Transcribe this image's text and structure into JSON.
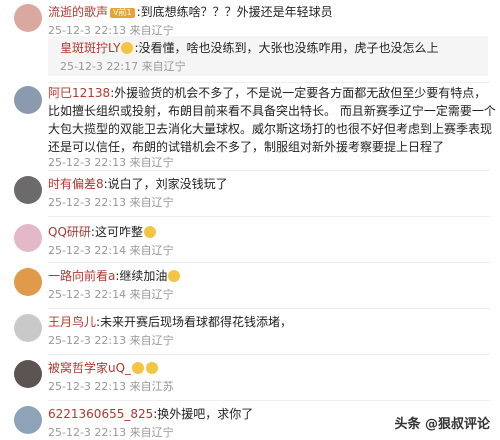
{
  "comments": [
    {
      "name": "流逝的歌声",
      "badge": "V前1",
      "text": ":到底想练啥？？？外援还是年轻球员",
      "date": "25-12-3 22:13",
      "loc": "来自辽宁"
    },
    {
      "name": "皇斑斑拧LY",
      "text": ":没看懂，啥也没练到，大张也没练咋用，虎子也没怎么上",
      "date": "25-12-3 22:17",
      "loc": "来自辽宁"
    },
    {
      "name": "阿巳12138",
      "text": ":外援验货的机会不多了，不是说一定要各方面都无敌但至少要有特点，比如擅长组织或投射，布朗目前来看不具备突出特长。 而且新赛季辽宁一定需要一个大包大揽型的双能卫去消化大量球权。威尔斯这场打的也很不好但考虑到上赛季表现还是可以信任，布朗的试错机会不多了，制服组对新外援考察要提上日程了",
      "date": "25-12-3 22:13",
      "loc": "来自辽宁"
    },
    {
      "name": "时有偏差8",
      "text": ":说白了，刘家没钱玩了",
      "date": "25-12-3 22:13",
      "loc": "来自辽宁"
    },
    {
      "name": "QQ研研",
      "text": ":这可咋整",
      "date": "25-12-3 22:14",
      "loc": "来自辽宁"
    },
    {
      "name": "一路向前看a",
      "text": ":继续加油",
      "date": "25-12-3 22:14",
      "loc": "来自辽宁"
    },
    {
      "name": "王月鸟儿",
      "text": ":未来开赛后现场看球都得花钱添堵，",
      "date": "25-12-3 22:13",
      "loc": "来自辽宁"
    },
    {
      "name": "被窝哲学家uQ_",
      "text": "",
      "date": "25-12-3 22:13",
      "loc": "来自江苏"
    },
    {
      "name": "6221360655_825",
      "text": ":换外援吧，求你了",
      "date": "25-12-3 22:13",
      "loc": "来自辽宁"
    }
  ],
  "footer": "头条 @狠叔评论",
  "colors": {
    "name": "#b0392f",
    "meta": "#999999"
  }
}
